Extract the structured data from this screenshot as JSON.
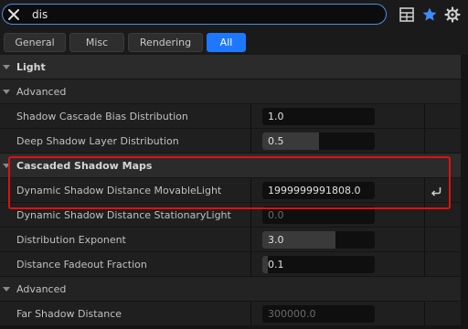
{
  "search": {
    "value": "dis",
    "placeholder": ""
  },
  "filters": [
    "General",
    "Misc",
    "Rendering",
    "All"
  ],
  "rows": [
    {
      "name": "Light"
    },
    {
      "name": "Advanced"
    },
    {
      "name": "Shadow Cascade Bias Distribution",
      "value": "1.0",
      "fill": 0.0
    },
    {
      "name": "Deep Shadow Layer Distribution",
      "value": "0.5",
      "fill": 0.5
    },
    {
      "name": "Cascaded Shadow Maps"
    },
    {
      "name": "Dynamic Shadow Distance MovableLight",
      "value": "1999999991808.0",
      "fill": 0.0
    },
    {
      "name": "Dynamic Shadow Distance StationaryLight",
      "value": "0.0"
    },
    {
      "name": "Distribution Exponent",
      "value": "3.0",
      "fill": 0.65
    },
    {
      "name": "Distance Fadeout Fraction",
      "value": "0.1",
      "fill": 0.05
    },
    {
      "name": "Advanced"
    },
    {
      "name": "Far Shadow Distance",
      "value": "300000.0"
    }
  ],
  "icons": {
    "clear": "close-icon",
    "table": "table-icon",
    "favorite": "star-icon",
    "settings": "gear-icon",
    "reset": "reset-arrow-icon"
  },
  "colors": {
    "accent": "#1e78ff",
    "highlight": "#e01010"
  }
}
